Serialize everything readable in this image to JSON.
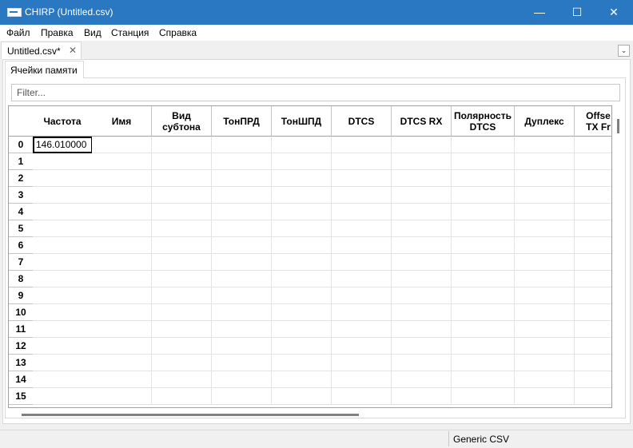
{
  "window": {
    "title": "CHIRP (Untitled.csv)",
    "minimize_glyph": "—",
    "maximize_glyph": "☐",
    "close_glyph": "✕"
  },
  "menu": [
    "Файл",
    "Правка",
    "Вид",
    "Станция",
    "Справка"
  ],
  "file_tab": {
    "label": "Untitled.csv*",
    "close_glyph": "✕"
  },
  "tab_dropdown_glyph": "⌄",
  "memory_tab": {
    "label": "Ячейки памяти"
  },
  "filter": {
    "placeholder": "Filter...",
    "value": ""
  },
  "table": {
    "columns": [
      "Частота",
      "Имя",
      "Вид\nсубтона",
      "ТонПРД",
      "ТонШПД",
      "DTCS",
      "DTCS RX",
      "Полярность\nDTCS",
      "Дуплекс",
      "Offse\nTX Fr"
    ],
    "rows": [
      "0",
      "1",
      "2",
      "3",
      "4",
      "5",
      "6",
      "7",
      "8",
      "9",
      "10",
      "11",
      "12",
      "13",
      "14",
      "15"
    ],
    "first_row_frequency": "146.010000"
  },
  "status": {
    "radio": "Generic CSV"
  }
}
